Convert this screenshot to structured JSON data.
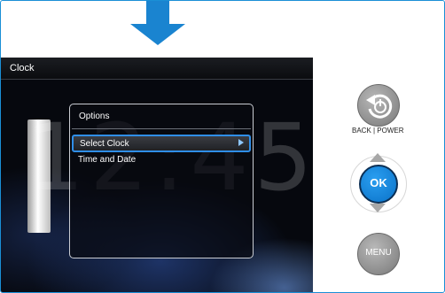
{
  "screen": {
    "title": "Clock",
    "clock_display": "12:45"
  },
  "options_dialog": {
    "title": "Options",
    "items": [
      {
        "label": "Select Clock",
        "selected": true
      },
      {
        "label": "Time and Date",
        "selected": false
      }
    ]
  },
  "controls": {
    "back_power_label": "BACK | POWER",
    "ok_label": "OK",
    "menu_label": "MENU"
  },
  "colors": {
    "accent_blue": "#1a8fd6",
    "selection_border": "#2f8ee8"
  },
  "icons": {
    "top_arrow": "down-arrow-icon",
    "back": "back-power-icon",
    "up": "up-triangle-icon",
    "down": "down-triangle-icon"
  }
}
